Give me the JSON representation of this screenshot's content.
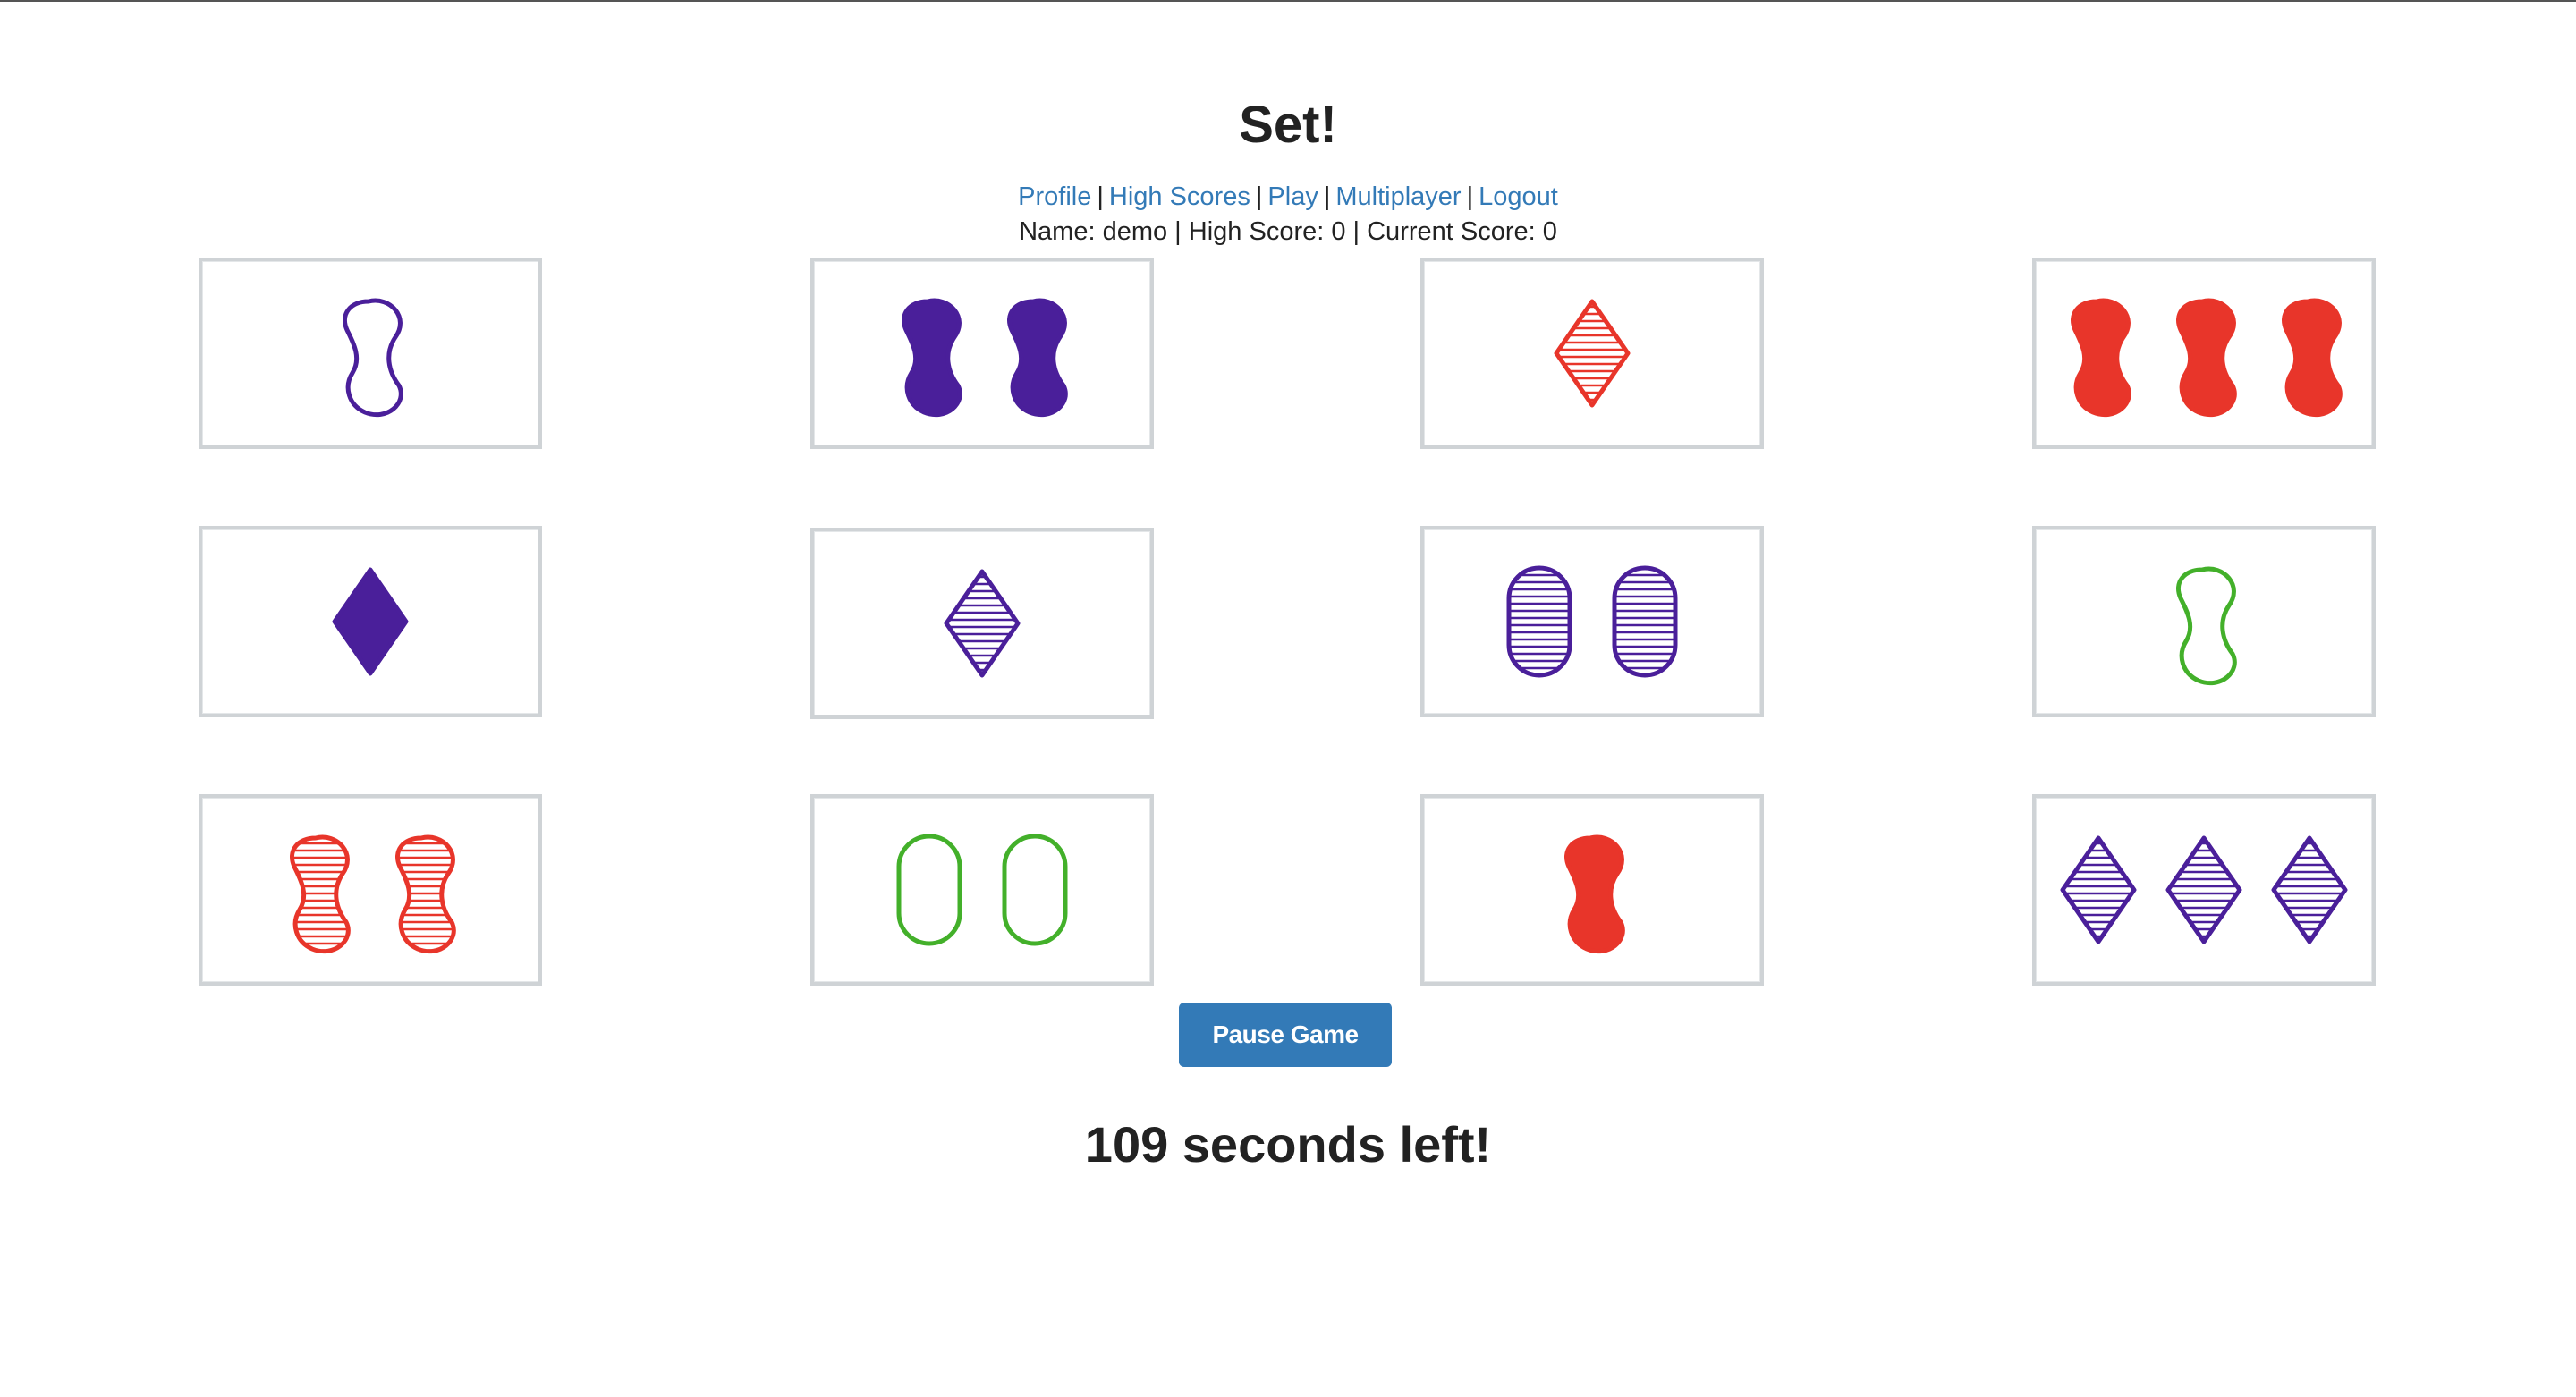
{
  "page": {
    "title": "Set!",
    "nav": [
      {
        "label": "Profile"
      },
      {
        "label": "High Scores"
      },
      {
        "label": "Play"
      },
      {
        "label": "Multiplayer"
      },
      {
        "label": "Logout"
      }
    ],
    "stats_text": "Name: demo | High Score: 0 | Current Score: 0",
    "pause_button_label": "Pause Game",
    "timer_text": "109 seconds left!"
  },
  "colors": {
    "purple": "#4a1f9a",
    "red": "#e8352a",
    "green": "#43b02a",
    "link": "#337ab7",
    "button": "#337ab7"
  },
  "board": {
    "cards": [
      {
        "count": 1,
        "color": "purple",
        "shape": "squiggle",
        "fill": "open"
      },
      {
        "count": 2,
        "color": "purple",
        "shape": "squiggle",
        "fill": "solid"
      },
      {
        "count": 1,
        "color": "red",
        "shape": "diamond",
        "fill": "striped"
      },
      {
        "count": 3,
        "color": "red",
        "shape": "squiggle",
        "fill": "solid"
      },
      {
        "count": 1,
        "color": "purple",
        "shape": "diamond",
        "fill": "solid"
      },
      {
        "count": 1,
        "color": "purple",
        "shape": "diamond",
        "fill": "striped"
      },
      {
        "count": 2,
        "color": "purple",
        "shape": "oval",
        "fill": "striped"
      },
      {
        "count": 1,
        "color": "green",
        "shape": "squiggle",
        "fill": "open"
      },
      {
        "count": 2,
        "color": "red",
        "shape": "squiggle",
        "fill": "striped"
      },
      {
        "count": 2,
        "color": "green",
        "shape": "oval",
        "fill": "open"
      },
      {
        "count": 1,
        "color": "red",
        "shape": "squiggle",
        "fill": "solid"
      },
      {
        "count": 3,
        "color": "purple",
        "shape": "diamond",
        "fill": "striped"
      }
    ]
  }
}
